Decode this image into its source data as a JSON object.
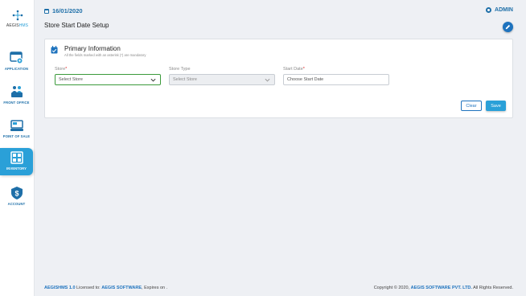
{
  "brand": {
    "part1": "AEGIS",
    "part2": "HMS"
  },
  "sidebar": {
    "items": [
      {
        "label": "APPLICATION",
        "icon": "application-gear-icon"
      },
      {
        "label": "FRONT OFFICE",
        "icon": "front-office-icon"
      },
      {
        "label": "POINT OF SALE",
        "icon": "point-of-sale-icon"
      },
      {
        "label": "INVENTORY",
        "icon": "inventory-icon",
        "active": true
      },
      {
        "label": "ACCOUNT",
        "icon": "account-dollar-icon"
      }
    ]
  },
  "header": {
    "date": "16/01/2020",
    "user": "ADMIN"
  },
  "page": {
    "title": "Store Start Date Setup"
  },
  "card": {
    "title": "Primary Information",
    "subtitle": "All the fields marked with an asterisk (*) are mandatory",
    "store": {
      "label": "Store",
      "required_mark": "*",
      "value": "Select Store"
    },
    "store_type": {
      "label": "Store Type",
      "value": "Select Store"
    },
    "start_date": {
      "label": "Start Date",
      "required_mark": "*",
      "placeholder": "Choose Start Date"
    },
    "clear_label": "Clear",
    "save_label": "Save"
  },
  "footer": {
    "product": "AEGISHMS 1.0",
    "licensed_text": " Licensed to: ",
    "licensee": "AEGIS SOFTWARE",
    "expires_text": ", Expires on .",
    "copyright_text": "Copyright © 2020, ",
    "company": "AEGIS SOFTWARE PVT. LTD.",
    "rights_text": " All Rights Reserved."
  },
  "colors": {
    "accent": "#2aa0d8",
    "primary": "#1e73be",
    "required": "#e02424"
  }
}
